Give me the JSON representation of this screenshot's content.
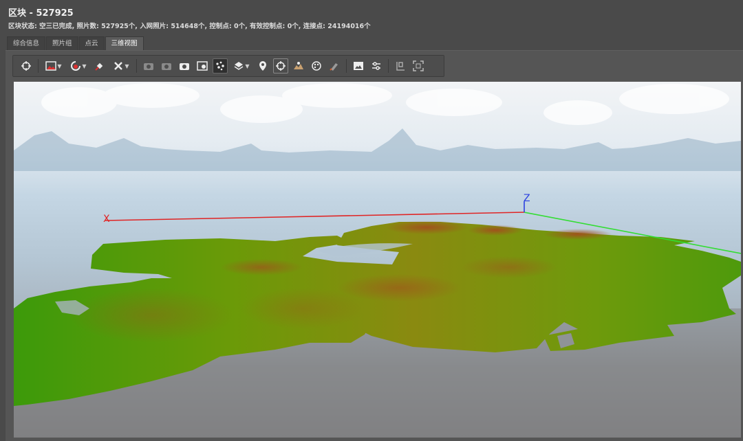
{
  "block": {
    "title": "区块 - 527925",
    "status": "区块状态: 空三已完成, 照片数: 527925个, 入网照片: 514648个, 控制点: 0个, 有效控制点: 0个, 连接点: 24194016个"
  },
  "tabs": [
    {
      "label": "综合信息",
      "active": false
    },
    {
      "label": "照片组",
      "active": false
    },
    {
      "label": "点云",
      "active": false
    },
    {
      "label": "三维视图",
      "active": true
    }
  ],
  "toolbar": {
    "icons": [
      "navigate-icon",
      "image-dropdown-icon",
      "color-dropdown-icon",
      "satellite-icon",
      "tools-dropdown-icon",
      "camera-icon",
      "camera-alt-icon",
      "photo-icon",
      "image-compare-icon",
      "point-cloud-icon",
      "layers-dropdown-icon",
      "location-pin-icon",
      "target-icon",
      "terrain-icon",
      "palette-icon",
      "brush-icon",
      "picture-icon",
      "sliders-icon",
      "measure-icon",
      "fit-view-icon"
    ]
  },
  "viewport": {
    "axis_x_label": "X",
    "axis_z_label": "Z",
    "colors": {
      "axis_x": "#e02424",
      "axis_y": "#33dd33",
      "axis_z": "#2a3fe0",
      "terrain_low": "#3e9a06",
      "terrain_mid": "#9a9a10",
      "terrain_high": "#a0521c",
      "sky_top": "#f3f5f7",
      "ground": "#8a8a8c"
    }
  }
}
